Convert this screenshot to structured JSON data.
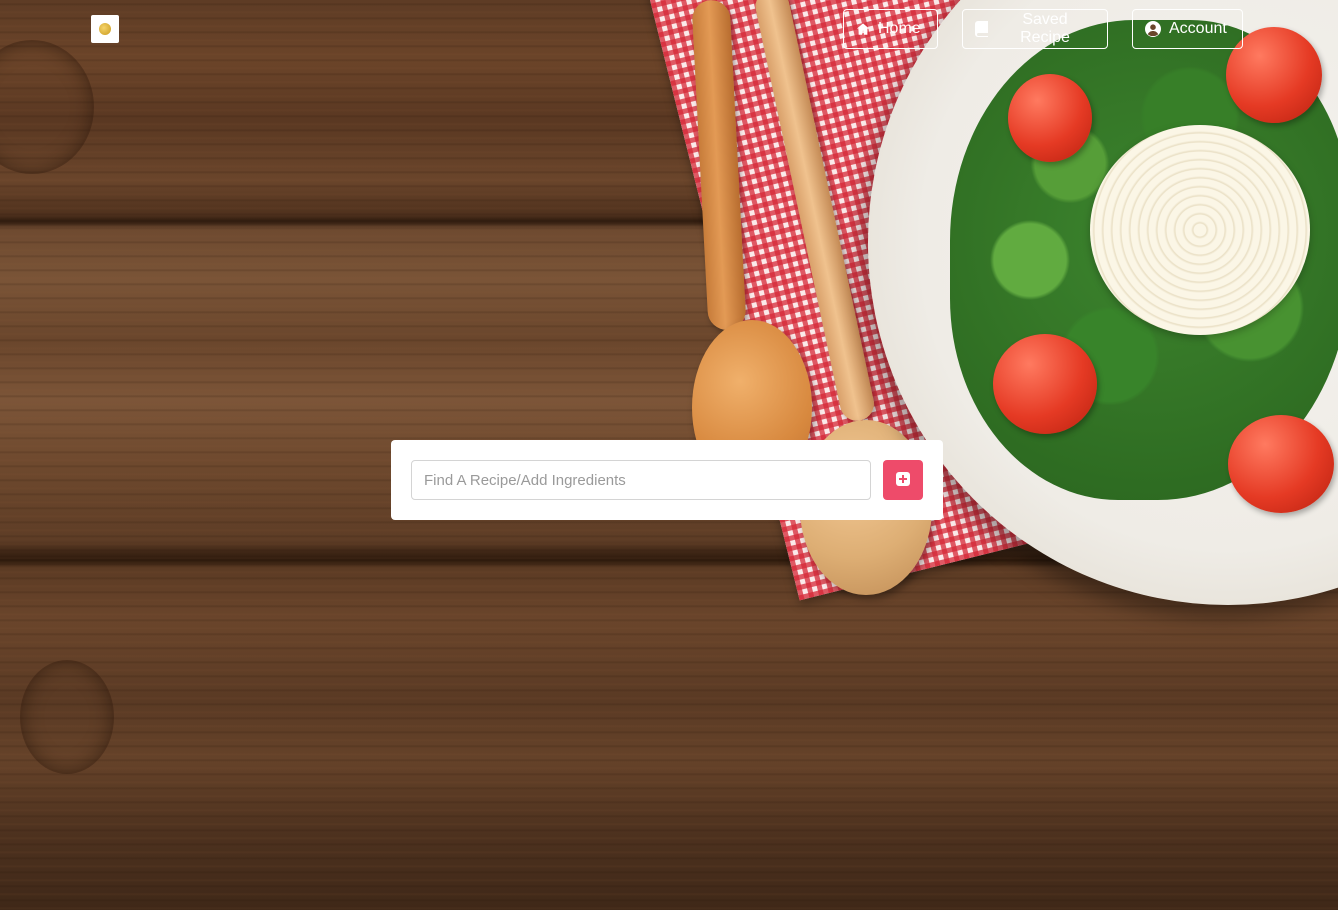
{
  "header": {
    "logo_icon": "logo-icon",
    "nav": {
      "home_label": "Home",
      "saved_label": "Saved Recipe",
      "account_label": "Account"
    }
  },
  "search": {
    "placeholder": "Find A Recipe/Add Ingredients",
    "value": "",
    "add_icon": "plus-square-icon",
    "accent_color": "#ee4b6a"
  },
  "colors": {
    "nav_border": "#ffffff",
    "card_background": "#ffffff"
  }
}
